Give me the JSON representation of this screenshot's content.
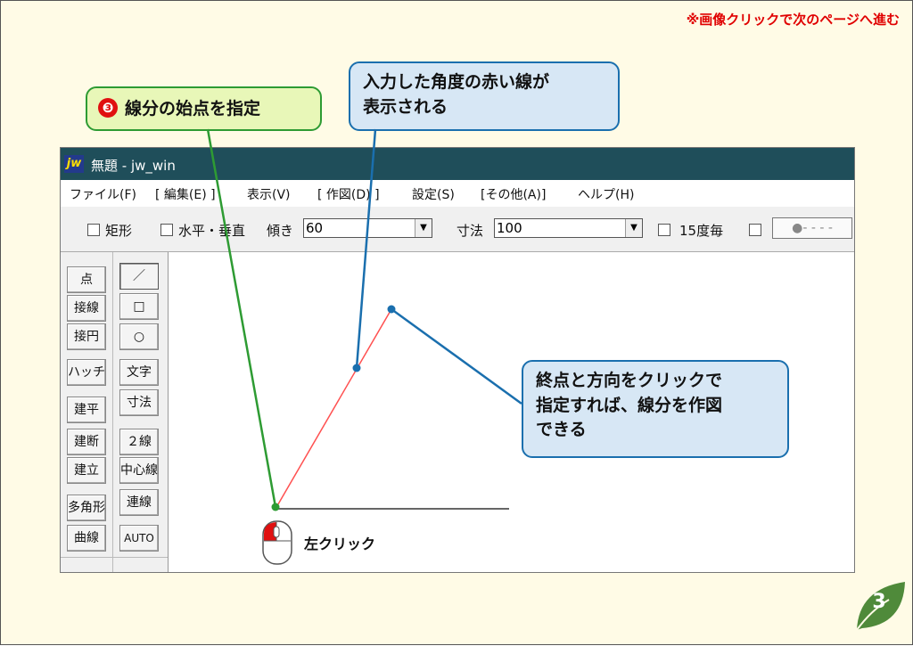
{
  "top_note": "※画像クリックで次のページへ進む",
  "callouts": {
    "start": {
      "number": "❸",
      "text": "線分の始点を指定"
    },
    "red_line": {
      "line1": "入力した角度の赤い線が",
      "line2": "表示される"
    },
    "end": {
      "line1": "終点と方向をクリックで",
      "line2": "指定すれば、線分を作図",
      "line3": "できる"
    }
  },
  "window": {
    "logo": "jw",
    "title": "無題 - jw_win",
    "menu": [
      "ファイル(F)",
      "[ 編集(E) ]",
      "表示(V)",
      "[ 作図(D) ]",
      "設定(S)",
      "[その他(A)]",
      "ヘルプ(H)"
    ],
    "toolbar": {
      "rect_label": "矩形",
      "hv_label": "水平・垂直",
      "angle_label": "傾き",
      "angle_value": "60",
      "dim_label": "寸法",
      "dim_value": "100",
      "deg15_label": "15度毎",
      "line_style": "●- - - -"
    },
    "left_tools": [
      "点",
      "接線",
      "接円",
      "ハッチ",
      "建平",
      "建断",
      "建立",
      "多角形",
      "曲線"
    ],
    "right_tools": [
      "／",
      "□",
      "○",
      "文字",
      "寸法",
      "２線",
      "中心線",
      "連線",
      "AUTO"
    ]
  },
  "mouse_label": "左クリック",
  "page_number": "3",
  "colors": {
    "accent_red": "#e00000",
    "green": "#2e9b33",
    "blue": "#1a6fae",
    "badge": "#4f8a3a"
  }
}
